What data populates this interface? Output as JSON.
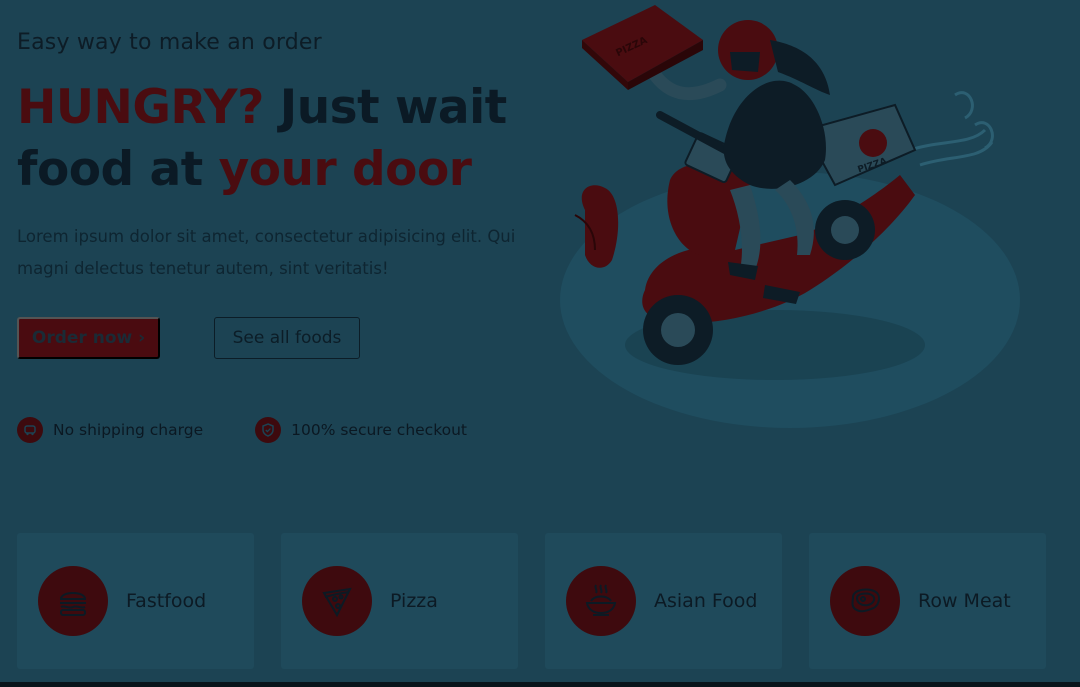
{
  "hero": {
    "subtitle": "Easy way to make an order",
    "headline_part1": "HUNGRY?",
    "headline_part2": " Just wait",
    "headline_part3": "food at ",
    "headline_part4": "your door",
    "description": "Lorem ipsum dolor sit amet, consectetur adipisicing elit. Qui magni delectus tenetur autem, sint veritatis!"
  },
  "buttons": {
    "order_label": "Order now ›",
    "see_all_label": "See all foods"
  },
  "features": [
    {
      "label": "No shipping charge",
      "icon": "car-icon"
    },
    {
      "label": "100% secure checkout",
      "icon": "shield-icon"
    }
  ],
  "illustration": {
    "box_text": "PIZZA",
    "scooter_text": "PIZZA"
  },
  "categories": [
    {
      "label": "Fastfood",
      "icon": "burger-icon"
    },
    {
      "label": "Pizza",
      "icon": "pizza-slice-icon"
    },
    {
      "label": "Asian Food",
      "icon": "noodle-bowl-icon"
    },
    {
      "label": "Row Meat",
      "icon": "steak-icon"
    }
  ],
  "colors": {
    "background": "#1c4353",
    "accent": "#4a0c10",
    "text": "#0c1a24"
  }
}
